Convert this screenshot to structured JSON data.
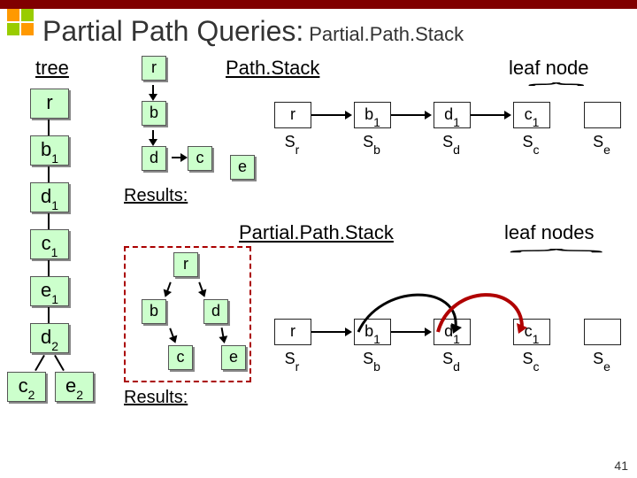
{
  "title": {
    "main": "Partial Path Queries:",
    "sub": "Partial.Path.Stack"
  },
  "tree": {
    "label": "tree",
    "nodes": {
      "r": "r",
      "b1": "b",
      "d1": "d",
      "c1": "c",
      "e1": "e",
      "d2": "d",
      "c2": "c",
      "e2": "e"
    },
    "subs": {
      "b1": "1",
      "d1": "1",
      "c1": "1",
      "e1": "1",
      "d2": "2",
      "c2": "2",
      "e2": "2"
    }
  },
  "pathstack": {
    "label": "Path.Stack",
    "query": [
      "r",
      "b",
      "d",
      "c",
      "e"
    ],
    "results_label": "Results:",
    "stacks": [
      {
        "top": "r",
        "name": "Sr",
        "sub": "r"
      },
      {
        "top": "b",
        "name": "Sb",
        "sub": "b",
        "topsub": "1"
      },
      {
        "top": "d",
        "name": "Sd",
        "sub": "d",
        "topsub": "1"
      },
      {
        "top": "c",
        "name": "Sc",
        "sub": "c",
        "topsub": "1"
      },
      {
        "top": "",
        "name": "Se",
        "sub": "e"
      }
    ],
    "leaf_label": "leaf node"
  },
  "partial": {
    "label": "Partial.Path.Stack",
    "query": [
      "r",
      "b",
      "d",
      "c",
      "e"
    ],
    "results_label": "Results:",
    "stacks": [
      {
        "top": "r",
        "name": "Sr",
        "sub": "r"
      },
      {
        "top": "b",
        "name": "Sb",
        "sub": "b",
        "topsub": "1"
      },
      {
        "top": "d",
        "name": "Sd",
        "sub": "d",
        "topsub": "1"
      },
      {
        "top": "c",
        "name": "Sc",
        "sub": "c",
        "topsub": "1"
      },
      {
        "top": "",
        "name": "Se",
        "sub": "e"
      }
    ],
    "leaf_label": "leaf nodes"
  },
  "page_number": "41"
}
